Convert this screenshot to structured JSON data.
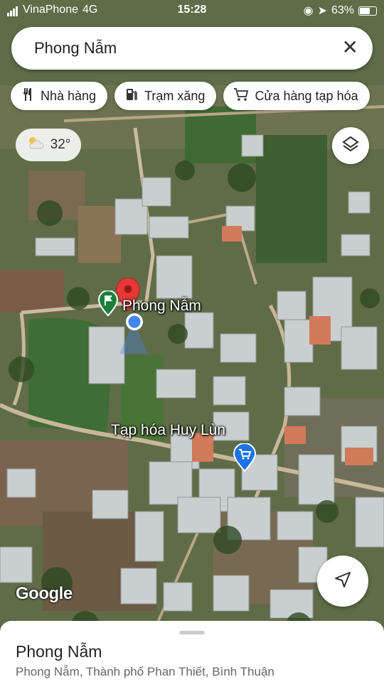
{
  "status_bar": {
    "carrier": "VinaPhone",
    "network": "4G",
    "time": "15:28",
    "battery": "63%"
  },
  "search": {
    "query": "Phong Nẫm",
    "clear_icon": "close-icon"
  },
  "chips": [
    {
      "label": "Nhà hàng",
      "icon": "restaurant-icon"
    },
    {
      "label": "Trạm xăng",
      "icon": "gas-station-icon"
    },
    {
      "label": "Cửa hàng tạp hóa",
      "icon": "cart-icon"
    }
  ],
  "weather": {
    "temp": "32°",
    "icon": "partly-cloudy-icon"
  },
  "map": {
    "place_label": "Phong Nẫm",
    "store_label": "Tạp hóa Huy Lùn",
    "attribution": "Google"
  },
  "place_sheet": {
    "title": "Phong Nẫm",
    "address": "Phong Nẫm, Thành phố Phan Thiết, Bình Thuận"
  },
  "colors": {
    "pin_red": "#e53935",
    "location_blue": "#4285f4",
    "store_blue": "#1a73e8",
    "flag_green": "#188038"
  }
}
